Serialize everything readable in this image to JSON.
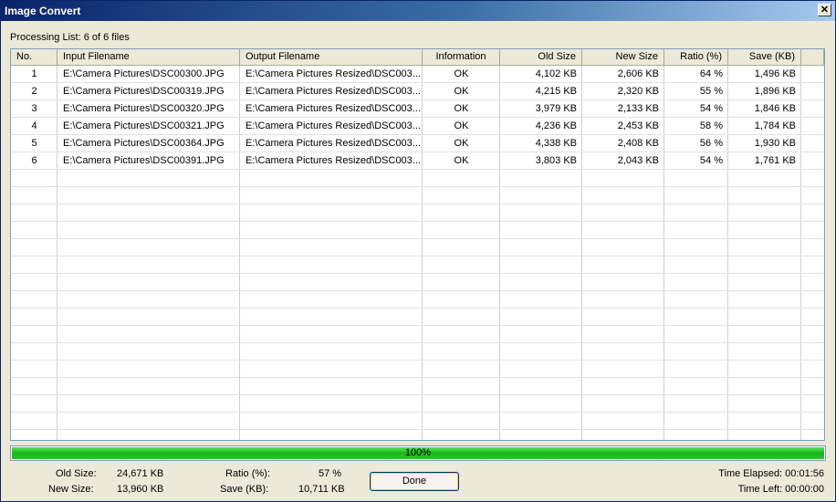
{
  "window": {
    "title": "Image Convert",
    "close_glyph": "✕"
  },
  "processing_label": "Processing List: 6 of 6 files",
  "columns": [
    "No.",
    "Input Filename",
    "Output Filename",
    "Information",
    "Old Size",
    "New Size",
    "Ratio (%)",
    "Save (KB)"
  ],
  "rows": [
    {
      "no": "1",
      "input": "E:\\Camera Pictures\\DSC00300.JPG",
      "output": "E:\\Camera Pictures Resized\\DSC003...",
      "info": "OK",
      "old": "4,102 KB",
      "new": "2,606 KB",
      "ratio": "64 %",
      "save": "1,496 KB"
    },
    {
      "no": "2",
      "input": "E:\\Camera Pictures\\DSC00319.JPG",
      "output": "E:\\Camera Pictures Resized\\DSC003...",
      "info": "OK",
      "old": "4,215 KB",
      "new": "2,320 KB",
      "ratio": "55 %",
      "save": "1,896 KB"
    },
    {
      "no": "3",
      "input": "E:\\Camera Pictures\\DSC00320.JPG",
      "output": "E:\\Camera Pictures Resized\\DSC003...",
      "info": "OK",
      "old": "3,979 KB",
      "new": "2,133 KB",
      "ratio": "54 %",
      "save": "1,846 KB"
    },
    {
      "no": "4",
      "input": "E:\\Camera Pictures\\DSC00321.JPG",
      "output": "E:\\Camera Pictures Resized\\DSC003...",
      "info": "OK",
      "old": "4,236 KB",
      "new": "2,453 KB",
      "ratio": "58 %",
      "save": "1,784 KB"
    },
    {
      "no": "5",
      "input": "E:\\Camera Pictures\\DSC00364.JPG",
      "output": "E:\\Camera Pictures Resized\\DSC003...",
      "info": "OK",
      "old": "4,338 KB",
      "new": "2,408 KB",
      "ratio": "56 %",
      "save": "1,930 KB"
    },
    {
      "no": "6",
      "input": "E:\\Camera Pictures\\DSC00391.JPG",
      "output": "E:\\Camera Pictures Resized\\DSC003...",
      "info": "OK",
      "old": "3,803 KB",
      "new": "2,043 KB",
      "ratio": "54 %",
      "save": "1,761 KB"
    }
  ],
  "progress": {
    "percent": 100,
    "label": "100%"
  },
  "summary": {
    "old_size_label": "Old Size:",
    "old_size_value": "24,671 KB",
    "new_size_label": "New Size:",
    "new_size_value": "13,960 KB",
    "ratio_label": "Ratio (%):",
    "ratio_value": "57 %",
    "save_label": "Save (KB):",
    "save_value": "10,711 KB",
    "elapsed": "Time Elapsed: 00:01:56",
    "left": "Time Left: 00:00:00"
  },
  "done_button": "Done",
  "colors": {
    "title_start": "#0a246a",
    "title_end": "#a6caf0",
    "progress_fill": "#1ab51a",
    "face": "#ece9d8"
  }
}
